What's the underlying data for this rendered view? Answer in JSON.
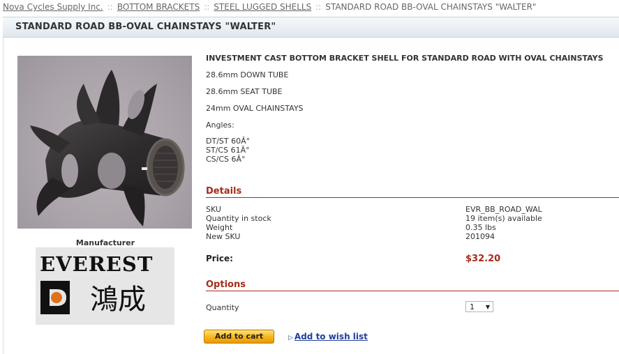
{
  "breadcrumb": {
    "items": [
      "Nova Cycles Supply Inc.",
      "BOTTOM BRACKETS",
      "STEEL LUGGED SHELLS"
    ],
    "separator": "::",
    "current": "STANDARD ROAD BB-OVAL CHAINSTAYS \"WALTER\""
  },
  "product": {
    "title": "STANDARD ROAD BB-OVAL CHAINSTAYS \"WALTER\"",
    "headline": "INVESTMENT CAST BOTTOM BRACKET SHELL FOR STANDARD ROAD WITH OVAL CHAINSTAYS",
    "specs": [
      "28.6mm DOWN TUBE",
      "28.6mm SEAT TUBE",
      "24mm OVAL CHAINSTAYS",
      "Angles:"
    ],
    "angles": [
      "DT/ST 60Â°",
      "ST/CS 61Â°",
      "CS/CS 6Â°"
    ]
  },
  "manufacturer": {
    "label": "Manufacturer",
    "logo_text": "EVEREST",
    "logo_chinese": "鴻成"
  },
  "details": {
    "title": "Details",
    "rows": [
      {
        "label": "SKU",
        "value": "EVR_BB_ROAD_WAL"
      },
      {
        "label": "Quantity in stock",
        "value": "19 item(s) available"
      },
      {
        "label": "Weight",
        "value": "0.35 lbs"
      },
      {
        "label": "New SKU",
        "value": "201094"
      }
    ],
    "price_label": "Price:",
    "price": "$32.20"
  },
  "options": {
    "title": "Options",
    "quantity_label": "Quantity",
    "quantity_value": "1"
  },
  "actions": {
    "add_to_cart": "Add to cart",
    "add_to_wishlist": "Add to wish list"
  },
  "colors": {
    "accent": "#a42c1c",
    "link": "#1f3f9a",
    "button": "#f6b417"
  }
}
